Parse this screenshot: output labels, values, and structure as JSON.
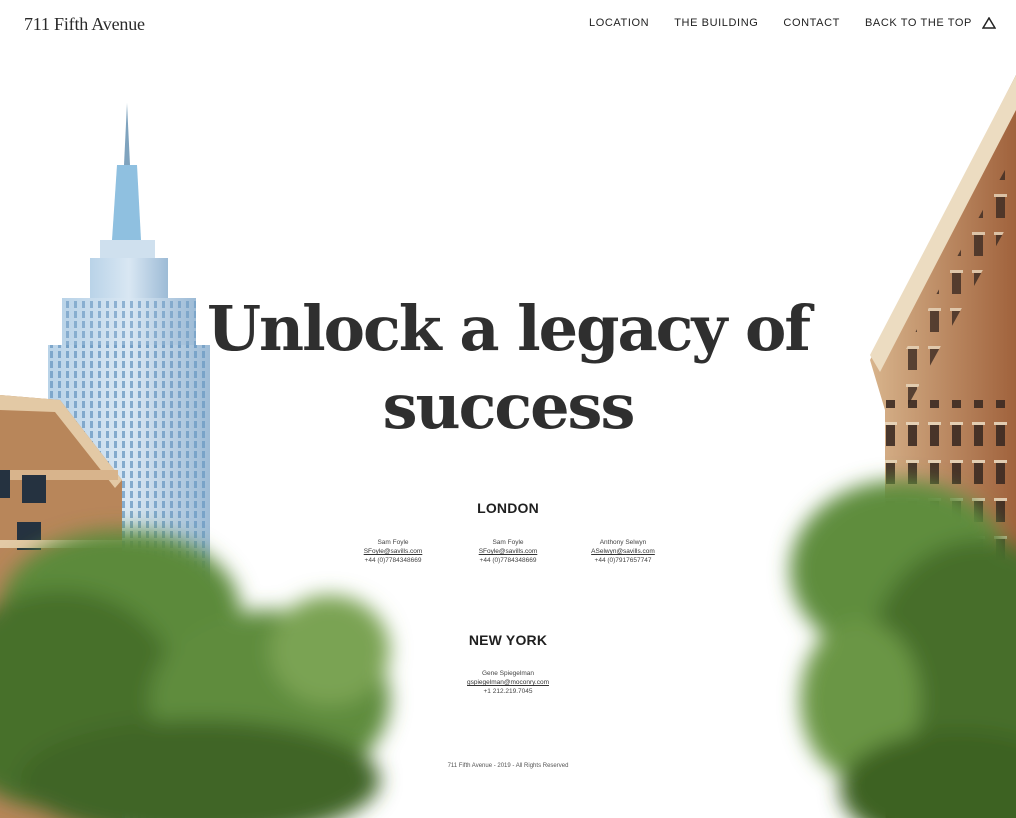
{
  "header": {
    "logo": "711 Fifth Avenue",
    "nav": [
      "LOCATION",
      "THE BUILDING",
      "CONTACT",
      "BACK TO THE TOP"
    ]
  },
  "hero": {
    "line1": "Unlock a legacy of",
    "line2": "success"
  },
  "london": {
    "title": "LONDON",
    "contacts": [
      {
        "name": "Sam Foyle",
        "email": "SFoyle@savills.com",
        "phone": "+44 (0)7784348669"
      },
      {
        "name": "Sam Foyle",
        "email": "SFoyle@savills.com",
        "phone": "+44 (0)7784348669"
      },
      {
        "name": "Anthony Selwyn",
        "email": "ASelwyn@savills.com",
        "phone": "+44 (0)7917657747"
      }
    ]
  },
  "new_york": {
    "title": "NEW YORK",
    "contacts": [
      {
        "name": "Gene Spiegelman",
        "email": "gspiegelman@moconry.com",
        "phone": "+1 212.219.7045"
      }
    ]
  },
  "footer": "711 Fifth Avenue - 2019 - All Rights Reserved",
  "colors": {
    "text": "#2f2f2f",
    "background": "#ffffff",
    "tree_green": "#4f7a32"
  }
}
